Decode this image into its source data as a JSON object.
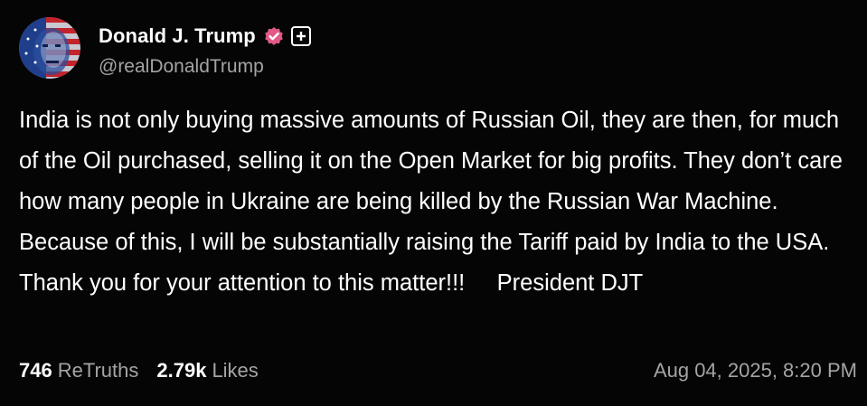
{
  "post": {
    "display_name": "Donald J. Trump",
    "handle": "@realDonaldTrump",
    "verified_icon": "verified-badge-icon",
    "plus_icon": "plus-icon",
    "body": "India is not only buying massive amounts of Russian Oil, they are then, for much of the Oil purchased, selling it on the Open Market for big profits. They don’t care how many people in Ukraine are being killed by the Russian War Machine. Because of this, I will be substantially raising the Tariff paid by India to the USA. Thank you for your attention to this matter!!!     President DJT",
    "retruths_count": "746",
    "retruths_label": "ReTruths",
    "likes_count": "2.79k",
    "likes_label": "Likes",
    "timestamp": "Aug 04, 2025, 8:20 PM"
  },
  "colors": {
    "background": "#050505",
    "text": "#ffffff",
    "muted": "#a4a4a4",
    "verified_badge": "#e15a86"
  }
}
